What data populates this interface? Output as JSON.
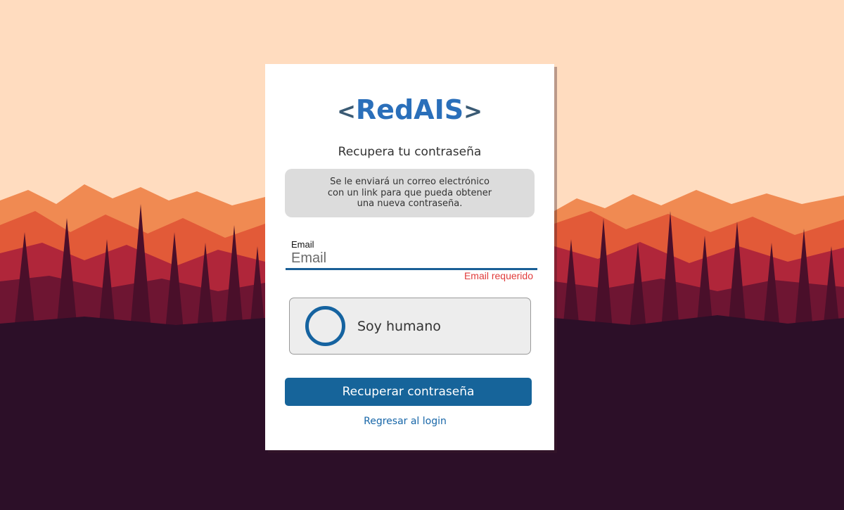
{
  "logo": {
    "left": "<",
    "word": "RedAIS",
    "right": ">"
  },
  "form": {
    "title": "Recupera tu contraseña",
    "info_lines": [
      "Se le enviará un correo electrónico",
      "con un link para que pueda obtener",
      "una nueva contraseña."
    ],
    "email_label": "Email",
    "email_placeholder": "Email",
    "email_value": "",
    "email_error": "Email requerido",
    "captcha_label": "Soy humano",
    "submit_label": "Recuperar contraseña",
    "back_link": "Regresar al login"
  },
  "colors": {
    "accent": "#16649a",
    "error": "#e03c3c",
    "logo_blue": "#2a6fba",
    "sky": "#ffdcbf",
    "ground": "#2c0f28"
  }
}
